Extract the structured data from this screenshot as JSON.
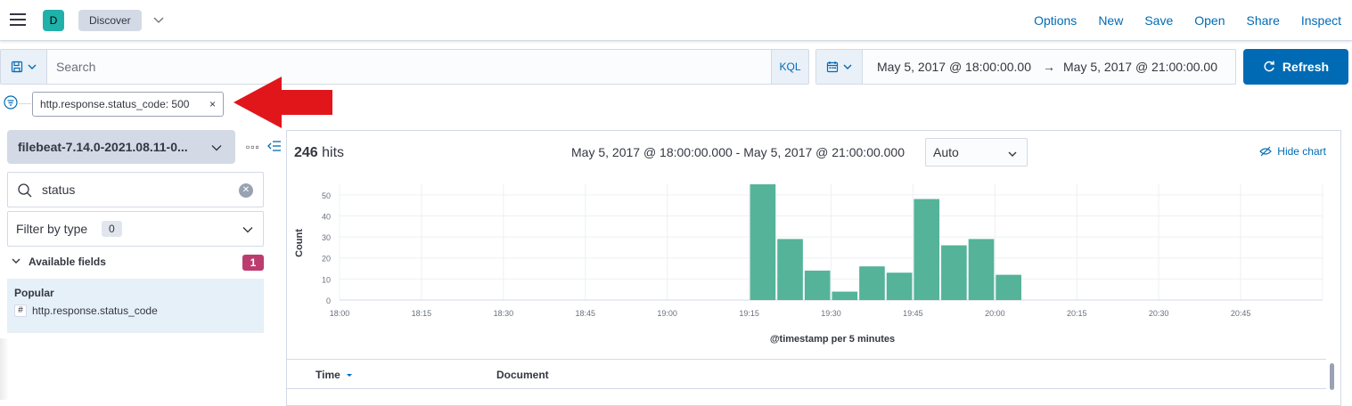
{
  "header": {
    "space_initial": "D",
    "breadcrumb": "Discover",
    "nav": [
      "Options",
      "New",
      "Save",
      "Open",
      "Share",
      "Inspect"
    ]
  },
  "query": {
    "placeholder": "Search",
    "language": "KQL"
  },
  "time": {
    "start": "May 5, 2017 @ 18:00:00.00",
    "arrow": "→",
    "end": "May 5, 2017 @ 21:00:00.00",
    "refresh_label": "Refresh"
  },
  "filter": {
    "pill_label": "http.response.status_code: 500",
    "remove": "×"
  },
  "sidebar": {
    "index_pattern": "filebeat-7.14.0-2021.08.11-0...",
    "options": "▫▫▫",
    "field_search_value": "status",
    "filter_by_type_label": "Filter by type",
    "filter_by_type_count": "0",
    "available_fields_label": "Available fields",
    "available_fields_count": "1",
    "popular_label": "Popular",
    "field_type_glyph": "#",
    "popular_field": "http.response.status_code"
  },
  "results": {
    "hits_count": "246",
    "hits_label": "hits",
    "range_text": "May 5, 2017 @ 18:00:00.000 - May 5, 2017 @ 21:00:00.000",
    "interval": "Auto",
    "hide_chart": "Hide chart"
  },
  "table": {
    "col_time": "Time",
    "col_document": "Document"
  },
  "colors": {
    "accent": "#006bb4",
    "bar": "#54b399",
    "avatar": "#20b2aa",
    "badge": "#bc3c6f",
    "arrow": "#e0161b"
  },
  "chart_data": {
    "type": "bar",
    "xlabel": "@timestamp per 5 minutes",
    "ylabel": "Count",
    "ylim": [
      0,
      55
    ],
    "yticks": [
      0,
      10,
      20,
      30,
      40,
      50
    ],
    "xticks": [
      "18:00",
      "18:15",
      "18:30",
      "18:45",
      "19:00",
      "19:15",
      "19:30",
      "19:45",
      "20:00",
      "20:15",
      "20:30",
      "20:45"
    ],
    "xlim_minutes": [
      0,
      180
    ],
    "bin_minutes": 5,
    "bins": [
      {
        "start": "19:15",
        "value": 55
      },
      {
        "start": "19:20",
        "value": 29
      },
      {
        "start": "19:25",
        "value": 14
      },
      {
        "start": "19:30",
        "value": 4
      },
      {
        "start": "19:35",
        "value": 16
      },
      {
        "start": "19:40",
        "value": 13
      },
      {
        "start": "19:45",
        "value": 48
      },
      {
        "start": "19:50",
        "value": 26
      },
      {
        "start": "19:55",
        "value": 29
      },
      {
        "start": "20:00",
        "value": 12
      }
    ]
  }
}
